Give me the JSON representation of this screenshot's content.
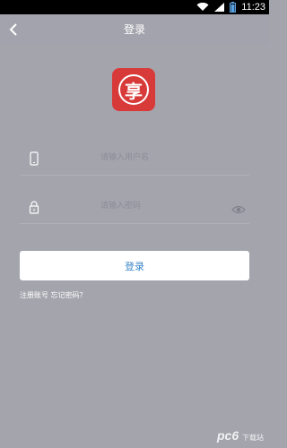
{
  "status_bar": {
    "time": "11:23"
  },
  "header": {
    "title": "登录",
    "back_icon": "back-chevron"
  },
  "logo": {
    "char": "享",
    "color": "#d83a3a"
  },
  "form": {
    "username_placeholder": "请输入用户名",
    "password_placeholder": "请输入密码",
    "login_label": "登录",
    "login_text_color": "#3b86c7"
  },
  "links": {
    "register": "注册账号",
    "forgot": "忘记密码？"
  },
  "watermark": {
    "brand": "pc6",
    "sub": "下载站"
  }
}
